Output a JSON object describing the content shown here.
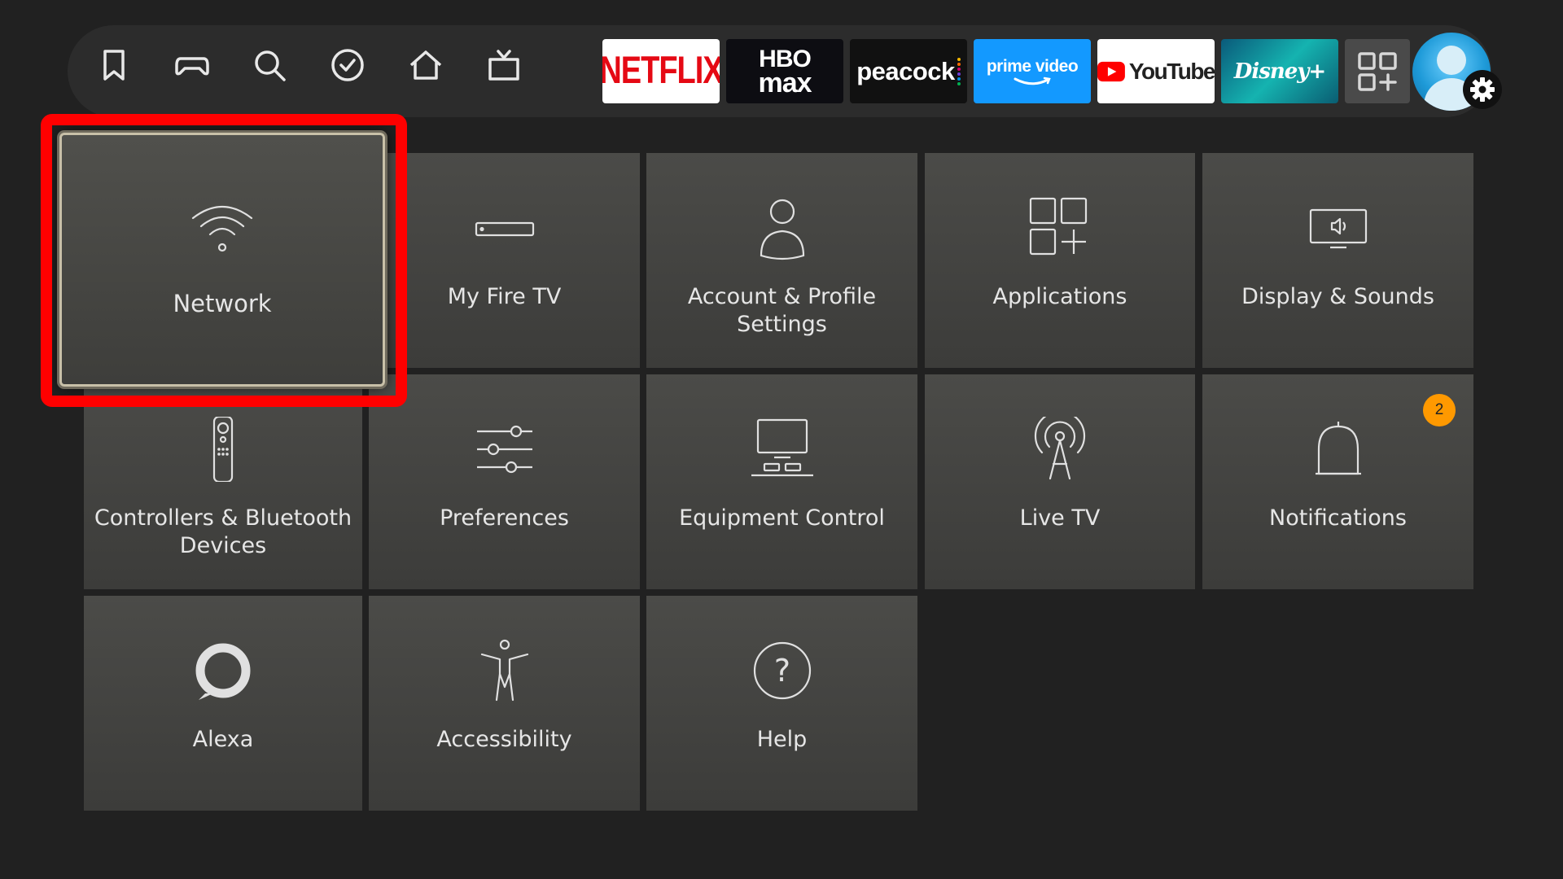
{
  "nav": {
    "icons": [
      {
        "id": "watchlist",
        "icon": "bookmark-icon"
      },
      {
        "id": "games",
        "icon": "gamepad-icon"
      },
      {
        "id": "search",
        "icon": "search-icon"
      },
      {
        "id": "check",
        "icon": "checkmark-circle-icon"
      },
      {
        "id": "home",
        "icon": "home-icon"
      },
      {
        "id": "live",
        "icon": "tv-icon"
      }
    ]
  },
  "apps": {
    "netflix": "NETFLIX",
    "hbo_line1": "HBO",
    "hbo_line2": "max",
    "peacock": "peacock",
    "prime": "prime video",
    "youtube": "YouTube",
    "disney": "Disney+",
    "all_apps_icon": "app-grid-icon"
  },
  "colors": {
    "focus_frame": "#ff0000",
    "badge": "#ff9900",
    "netflix": "#e50914",
    "prime": "#1399ff"
  },
  "tiles": {
    "network": {
      "label": "Network",
      "icon": "wifi-icon"
    },
    "my_fire_tv": {
      "label": "My Fire TV",
      "icon": "fire-tv-device-icon"
    },
    "account": {
      "label": "Account & Profile Settings",
      "icon": "user-icon"
    },
    "applications": {
      "label": "Applications",
      "icon": "apps-grid-icon"
    },
    "display": {
      "label": "Display & Sounds",
      "icon": "monitor-sound-icon"
    },
    "controllers": {
      "label": "Controllers & Bluetooth Devices",
      "icon": "remote-icon"
    },
    "preferences": {
      "label": "Preferences",
      "icon": "sliders-icon"
    },
    "equipment": {
      "label": "Equipment Control",
      "icon": "equipment-icon"
    },
    "live_tv": {
      "label": "Live TV",
      "icon": "antenna-icon"
    },
    "notifications": {
      "label": "Notifications",
      "icon": "bell-icon",
      "badge": "2"
    },
    "alexa": {
      "label": "Alexa",
      "icon": "alexa-icon"
    },
    "accessibility": {
      "label": "Accessibility",
      "icon": "accessibility-icon"
    },
    "help": {
      "label": "Help",
      "icon": "help-icon"
    }
  }
}
